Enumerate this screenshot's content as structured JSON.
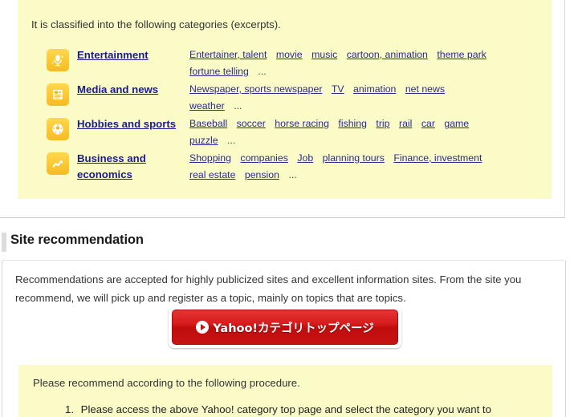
{
  "top_section": {
    "intro_text": "It is classified into the following categories (excerpts).",
    "categories": [
      {
        "icon": "microphone-icon",
        "name": "Entertainment",
        "links": [
          "Entertainer, talent",
          "movie",
          "music",
          "cartoon, animation",
          "theme park",
          "fortune telling"
        ],
        "ellipsis": "..."
      },
      {
        "icon": "newspaper-icon",
        "name": "Media and news",
        "links": [
          "Newspaper, sports newspaper",
          "TV",
          "animation",
          "net news",
          "weather"
        ],
        "ellipsis": "..."
      },
      {
        "icon": "soccer-ball-icon",
        "name": "Hobbies and sports",
        "links": [
          "Baseball",
          "soccer",
          "horse racing",
          "fishing",
          "trip",
          "rail",
          "car",
          "game",
          "puzzle"
        ],
        "ellipsis": "..."
      },
      {
        "icon": "chart-arrow-up-icon",
        "name": "Business and economics",
        "links": [
          "Shopping",
          "companies",
          "Job",
          "planning tours",
          "Finance, investment",
          "real estate",
          "pension"
        ],
        "ellipsis": "..."
      }
    ]
  },
  "site_recommendation": {
    "heading": "Site recommendation",
    "paragraph": "Recommendations are accepted for highly publicized sites and excellent information sites. From the site you recommend, we will pick up and register as a topic, mainly on topics that are topics.",
    "button": {
      "label": "Yahoo!カテゴリトップページ",
      "icon": "play-circle-icon",
      "color": "#c71212"
    },
    "procedure": {
      "heading": "Please recommend according to the following procedure.",
      "items": [
        {
          "number": "1.",
          "text": "Please access the above Yahoo! category top page and select the category you want to"
        }
      ]
    }
  },
  "colors": {
    "panel_yellow": "#fbfbc8",
    "link_blue": "#2b2b8a",
    "heading_dark": "#1a1a1a",
    "icon_gold": "#f5bb22",
    "button_red": "#c71212"
  }
}
